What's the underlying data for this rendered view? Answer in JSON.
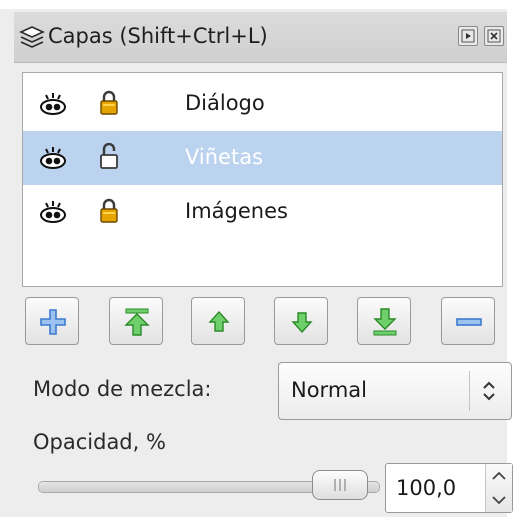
{
  "panel": {
    "title": "Capas (Shift+Ctrl+L)",
    "title_icon": "layers-icon",
    "controls": [
      "dock-toggle-icon",
      "close-icon"
    ]
  },
  "layers": [
    {
      "name": "Diálogo",
      "visible": true,
      "locked": true,
      "selected": false
    },
    {
      "name": "Viñetas",
      "visible": true,
      "locked": false,
      "selected": true
    },
    {
      "name": "Imágenes",
      "visible": true,
      "locked": true,
      "selected": false
    }
  ],
  "actions": [
    {
      "icon": "add-layer-icon",
      "color": "#3c7ad0"
    },
    {
      "icon": "raise-to-top-icon",
      "color": "#3db53a"
    },
    {
      "icon": "raise-layer-icon",
      "color": "#3db53a"
    },
    {
      "icon": "lower-layer-icon",
      "color": "#3db53a"
    },
    {
      "icon": "lower-to-bottom-icon",
      "color": "#3db53a"
    },
    {
      "icon": "remove-layer-icon",
      "color": "#3c7ad0"
    }
  ],
  "blend": {
    "label": "Modo de mezcla:",
    "value": "Normal"
  },
  "opacity": {
    "label": "Opacidad, %",
    "value": "100,0",
    "level": 1.0
  },
  "colors": {
    "selection": "#bcd3ef",
    "lock": "#e5a400",
    "arrow_green": "#3db53a",
    "add_blue": "#3c7ad0"
  }
}
